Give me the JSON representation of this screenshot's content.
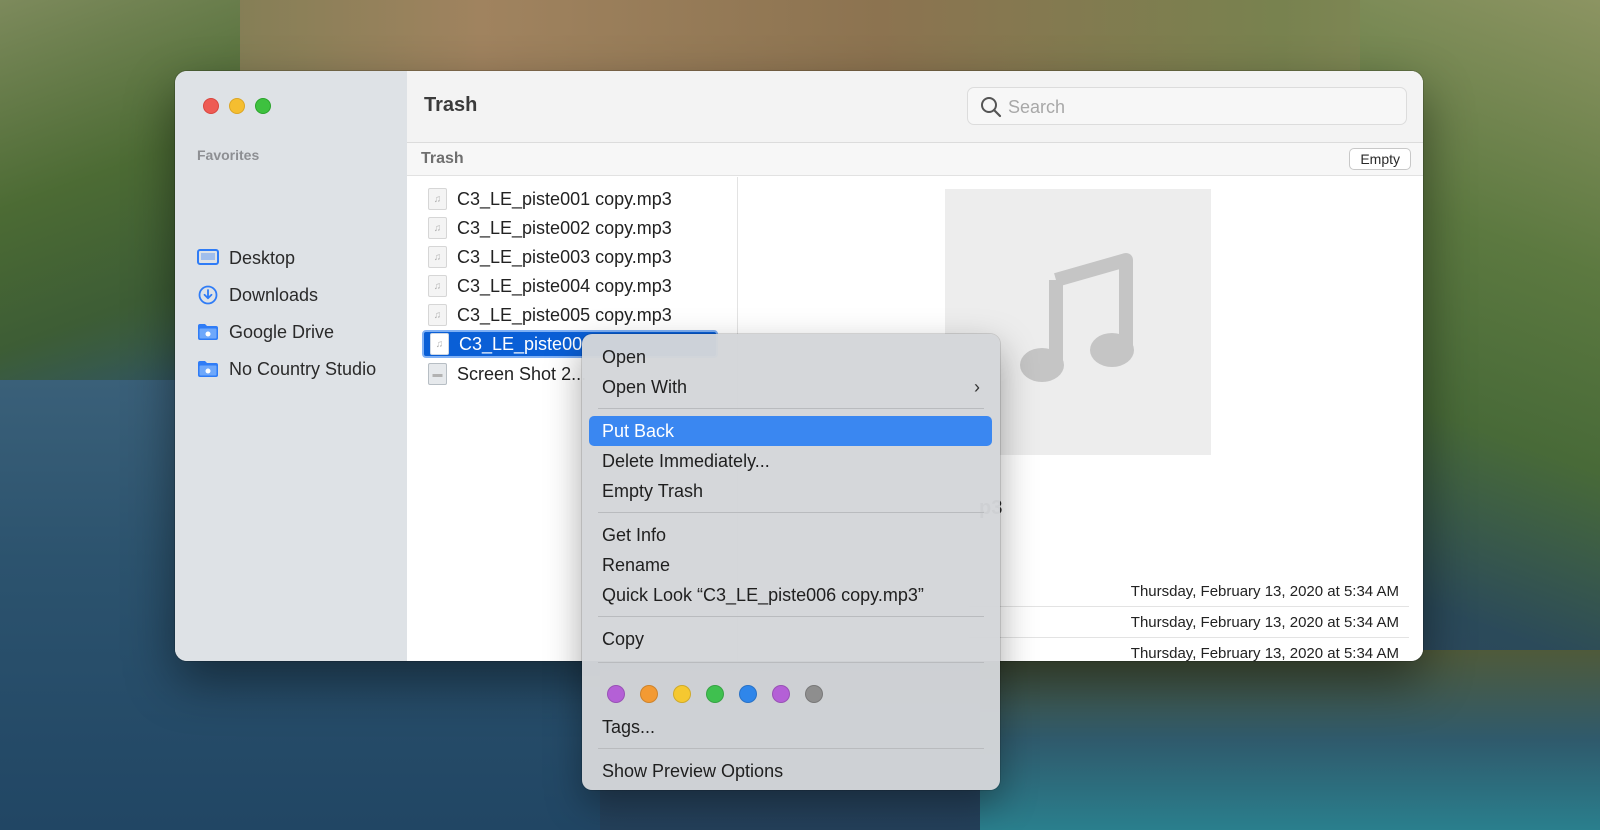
{
  "window": {
    "title": "Trash",
    "search_placeholder": "Search"
  },
  "sidebar": {
    "heading": "Favorites",
    "items": [
      {
        "label": "Desktop",
        "icon": "desktop-icon"
      },
      {
        "label": "Downloads",
        "icon": "downloads-icon"
      },
      {
        "label": "Google Drive",
        "icon": "folder-icon"
      },
      {
        "label": "No Country Studio",
        "icon": "folder-icon"
      }
    ]
  },
  "pathbar": {
    "title": "Trash",
    "empty_label": "Empty"
  },
  "files": [
    {
      "name": "C3_LE_piste001 copy.mp3",
      "icon": "audio-file-icon",
      "selected": false
    },
    {
      "name": "C3_LE_piste002 copy.mp3",
      "icon": "audio-file-icon",
      "selected": false
    },
    {
      "name": "C3_LE_piste003 copy.mp3",
      "icon": "audio-file-icon",
      "selected": false
    },
    {
      "name": "C3_LE_piste004 copy.mp3",
      "icon": "audio-file-icon",
      "selected": false
    },
    {
      "name": "C3_LE_piste005 copy.mp3",
      "icon": "audio-file-icon",
      "selected": false
    },
    {
      "name": "C3_LE_piste00",
      "icon": "audio-file-icon",
      "selected": true
    },
    {
      "name": "Screen Shot 2...",
      "icon": "screenshot-file-icon",
      "selected": false
    }
  ],
  "preview": {
    "filename_fragment": "p3",
    "icon": "music-note-icon",
    "dates": [
      "Thursday, February 13, 2020 at 5:34 AM",
      "Thursday, February 13, 2020 at 5:34 AM",
      "Thursday, February 13, 2020 at 5:34 AM"
    ]
  },
  "context_menu": {
    "items": {
      "open": "Open",
      "open_with": "Open With",
      "put_back": "Put Back",
      "delete_immediately": "Delete Immediately...",
      "empty_trash": "Empty Trash",
      "get_info": "Get Info",
      "rename": "Rename",
      "quick_look": "Quick Look “C3_LE_piste006 copy.mp3”",
      "copy": "Copy",
      "tags": "Tags...",
      "show_preview_options": "Show Preview Options"
    },
    "highlighted": "put_back",
    "tag_colors": [
      "#b460d6",
      "#f39a33",
      "#f5c830",
      "#3fc04f",
      "#2f86ea",
      "#b460d6",
      "#8e8e8e"
    ]
  }
}
